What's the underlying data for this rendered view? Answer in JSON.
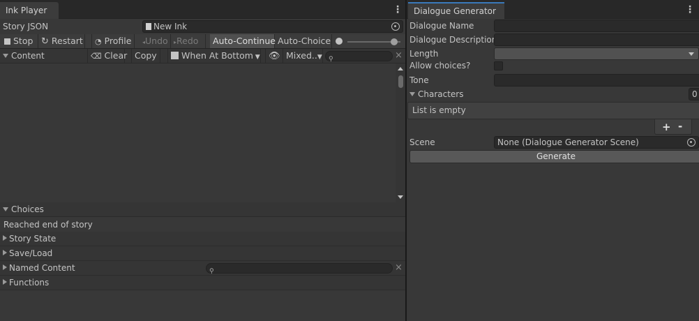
{
  "ink_player": {
    "tab_title": "Ink Player",
    "menu_glyph": "⋮",
    "story_json_label": "Story JSON",
    "story_json_value": "New Ink",
    "toolbar": {
      "stop": "Stop",
      "restart": "Restart",
      "profile": "Profile",
      "undo": "Undo",
      "redo": "Redo",
      "auto_continue": "Auto-Continue",
      "auto_choice": "Auto-Choice"
    },
    "content": {
      "header": "Content",
      "clear": "Clear",
      "copy": "Copy",
      "when_at_bottom": "When At Bottom",
      "mixed": "Mixed..",
      "search_value": ""
    },
    "choices": {
      "header": "Choices",
      "status": "Reached end of story"
    },
    "sections": [
      "Story State",
      "Save/Load",
      "Named Content",
      "Functions"
    ],
    "named_content_search": ""
  },
  "dialogue_generator": {
    "tab_title": "Dialogue Generator",
    "menu_glyph": "⋮",
    "fields": {
      "name_label": "Dialogue Name",
      "name_value": "",
      "description_label": "Dialogue Description",
      "description_value": "",
      "length_label": "Length",
      "length_value": "",
      "allow_choices_label": "Allow choices?",
      "tone_label": "Tone",
      "tone_value": ""
    },
    "characters": {
      "header": "Characters",
      "count": "0",
      "empty_text": "List is empty",
      "add": "+",
      "remove": "-"
    },
    "scene": {
      "label": "Scene",
      "value": "None (Dialogue Generator Scene)"
    },
    "generate": "Generate"
  },
  "colors": {
    "accent_tab": "#3a79bb",
    "panel_bg": "#383838",
    "field_bg": "#2a2a2a",
    "active_toggle": "#4f4f4f"
  }
}
